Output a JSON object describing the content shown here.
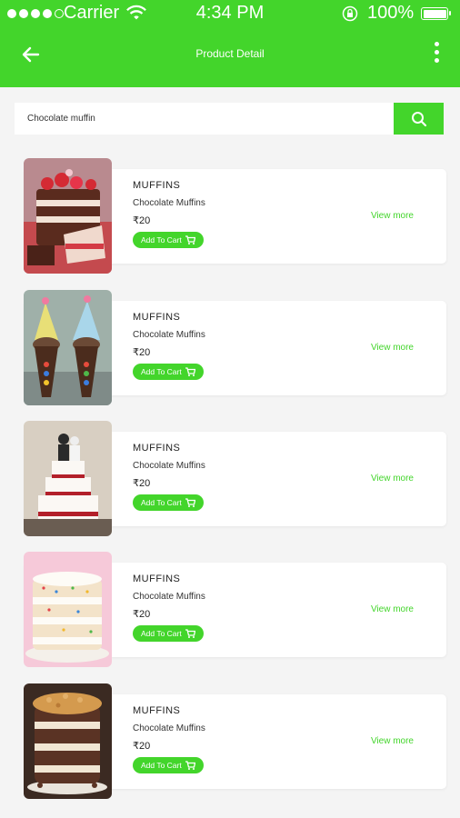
{
  "status_bar": {
    "carrier": "Carrier",
    "time": "4:34 PM",
    "battery": "100%"
  },
  "app_bar": {
    "title": "Product Detail",
    "back_icon": "arrow-left-icon",
    "menu_icon": "more-vertical-icon"
  },
  "search": {
    "value": "Chocolate muffin",
    "icon": "search-icon"
  },
  "products": [
    {
      "category": "MUFFINS",
      "name": "Chocolate Muffins",
      "price": "₹20",
      "add_label": "Add To Cart",
      "view_label": "View more",
      "image": "layered-strawberry-cake"
    },
    {
      "category": "MUFFINS",
      "name": "Chocolate Muffins",
      "price": "₹20",
      "add_label": "Add To Cart",
      "view_label": "View more",
      "image": "party-hat-cupcake-cones"
    },
    {
      "category": "MUFFINS",
      "name": "Chocolate Muffins",
      "price": "₹20",
      "add_label": "Add To Cart",
      "view_label": "View more",
      "image": "tiered-wedding-cake"
    },
    {
      "category": "MUFFINS",
      "name": "Chocolate Muffins",
      "price": "₹20",
      "add_label": "Add To Cart",
      "view_label": "View more",
      "image": "naked-sprinkle-cake"
    },
    {
      "category": "MUFFINS",
      "name": "Chocolate Muffins",
      "price": "₹20",
      "add_label": "Add To Cart",
      "view_label": "View more",
      "image": "chocolate-crumble-cake"
    }
  ],
  "colors": {
    "accent": "#43d52b",
    "background": "#f4f4f4"
  }
}
